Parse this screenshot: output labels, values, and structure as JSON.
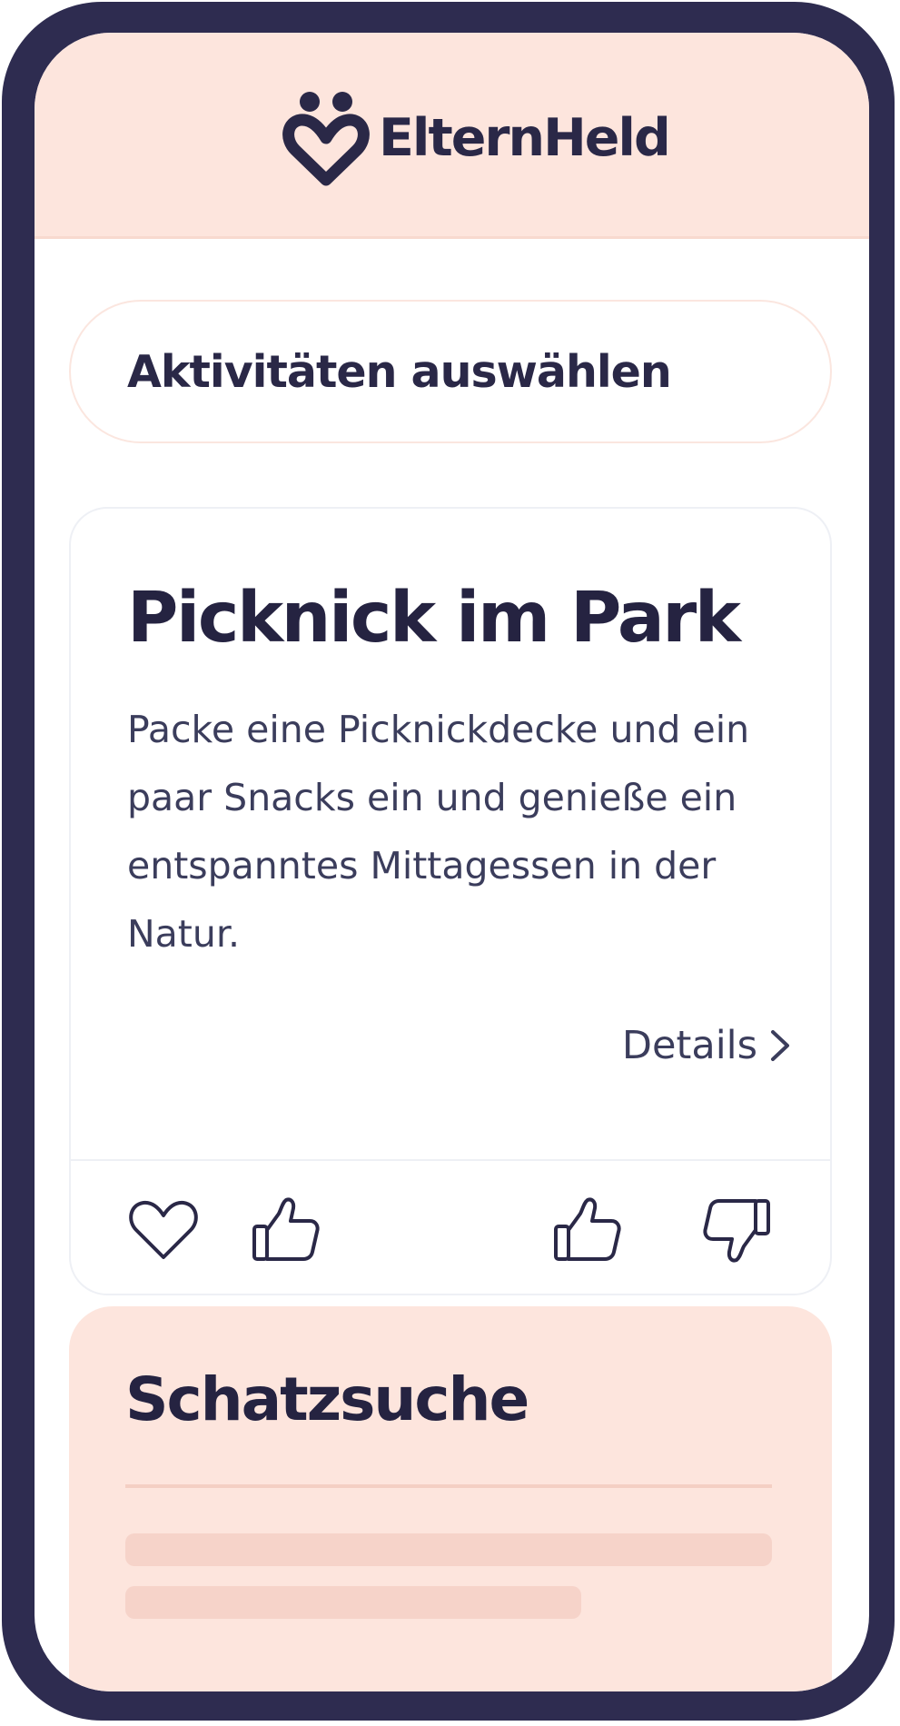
{
  "app": {
    "name": "ElternHeld"
  },
  "header": {
    "logo_icon": "heart-face-logo-icon"
  },
  "activity_selector": {
    "label": "Aktivitäten auswählen"
  },
  "activity_card": {
    "title": "Picknick im Park",
    "description": "Packe eine Picknickdecke und ein paar Snacks ein und genieße ein entspanntes Mittagessen in der Natur.",
    "details_label": "Details",
    "actions": [
      {
        "name": "favorite",
        "icon": "heart-outline-icon"
      },
      {
        "name": "like",
        "icon": "thumbs-up-icon"
      },
      {
        "name": "like",
        "icon": "thumbs-up-icon"
      },
      {
        "name": "dislike",
        "icon": "thumbs-down-icon"
      }
    ]
  },
  "next_card": {
    "title": "Schatzsuche"
  },
  "colors": {
    "frame": "#2e2c50",
    "header_background": "#fde5dd",
    "text_primary": "#252341",
    "text_secondary": "#3b3d5c",
    "placeholder": "#f6d3c9"
  }
}
